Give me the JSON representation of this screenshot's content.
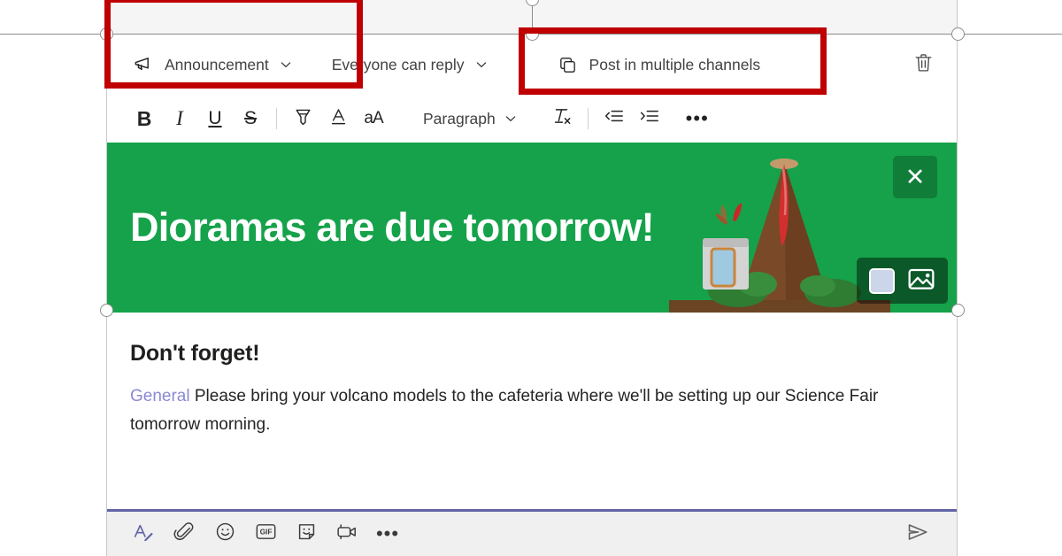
{
  "app": "microsoft-teams-announcement-composer",
  "colors": {
    "banner_green": "#15a24a",
    "banner_green_dark": "#0f7f39",
    "accent_purple": "#6264a7",
    "mention_purple": "#8a8ad4",
    "callout_red": "#c00000",
    "volcano_brown": "#7a4a28",
    "lava_red": "#d32f2f",
    "foliage_green": "#2e7d32",
    "swatch_fill": "#ccd6ea"
  },
  "options": {
    "announcement": {
      "label": "Announcement",
      "icon": "megaphone-icon",
      "chevron": "chevron-down-icon"
    },
    "reply_scope": {
      "label": "Everyone can reply",
      "chevron": "chevron-down-icon"
    },
    "multi_channel": {
      "label": "Post in multiple channels",
      "icon": "copy-icon"
    },
    "delete": {
      "icon": "trash-icon",
      "label": "Delete"
    }
  },
  "format_toolbar": {
    "bold": {
      "label": "B",
      "name": "bold-button"
    },
    "italic": {
      "label": "I",
      "name": "italic-button"
    },
    "underline": {
      "label": "U",
      "name": "underline-button"
    },
    "strikethrough": {
      "label": "S",
      "name": "strikethrough-button"
    },
    "highlight": {
      "name": "highlight-icon"
    },
    "font_color": {
      "label": "A",
      "name": "font-color-icon"
    },
    "font_size": {
      "label": "aA",
      "name": "font-size-icon"
    },
    "paragraph": {
      "label": "Paragraph",
      "chevron": "chevron-down-icon"
    },
    "clear_format": {
      "label": "Tx",
      "name": "clear-formatting-icon"
    },
    "decrease_indent": {
      "name": "decrease-indent-icon"
    },
    "increase_indent": {
      "name": "increase-indent-icon"
    },
    "more": {
      "label": "•••",
      "name": "more-options-icon"
    }
  },
  "banner": {
    "headline": "Dioramas are due tomorrow!",
    "close_label": "✕",
    "background_color": "#15a24a",
    "controls": {
      "color_swatch": "color-swatch",
      "image_picker": "image-picker-icon"
    },
    "illustration": "volcano-diorama-illustration"
  },
  "message": {
    "heading": "Don't forget!",
    "mention": "General",
    "body": " Please bring your volcano models to the cafeteria where we'll be setting up our Science Fair tomorrow morning."
  },
  "bottom_toolbar": {
    "items": [
      {
        "name": "format-button",
        "label": "Format",
        "active": true
      },
      {
        "name": "attach-button",
        "label": "Attach"
      },
      {
        "name": "emoji-button",
        "label": "Emoji"
      },
      {
        "name": "giphy-button",
        "label": "GIF"
      },
      {
        "name": "sticker-button",
        "label": "Sticker"
      },
      {
        "name": "meet-now-button",
        "label": "Meet now"
      },
      {
        "name": "more-actions-button",
        "label": "•••"
      }
    ],
    "send": {
      "name": "send-button",
      "label": "Send"
    }
  },
  "annotations": {
    "callout_1": "announcement-type-highlight",
    "callout_2": "post-in-multiple-channels-highlight"
  }
}
